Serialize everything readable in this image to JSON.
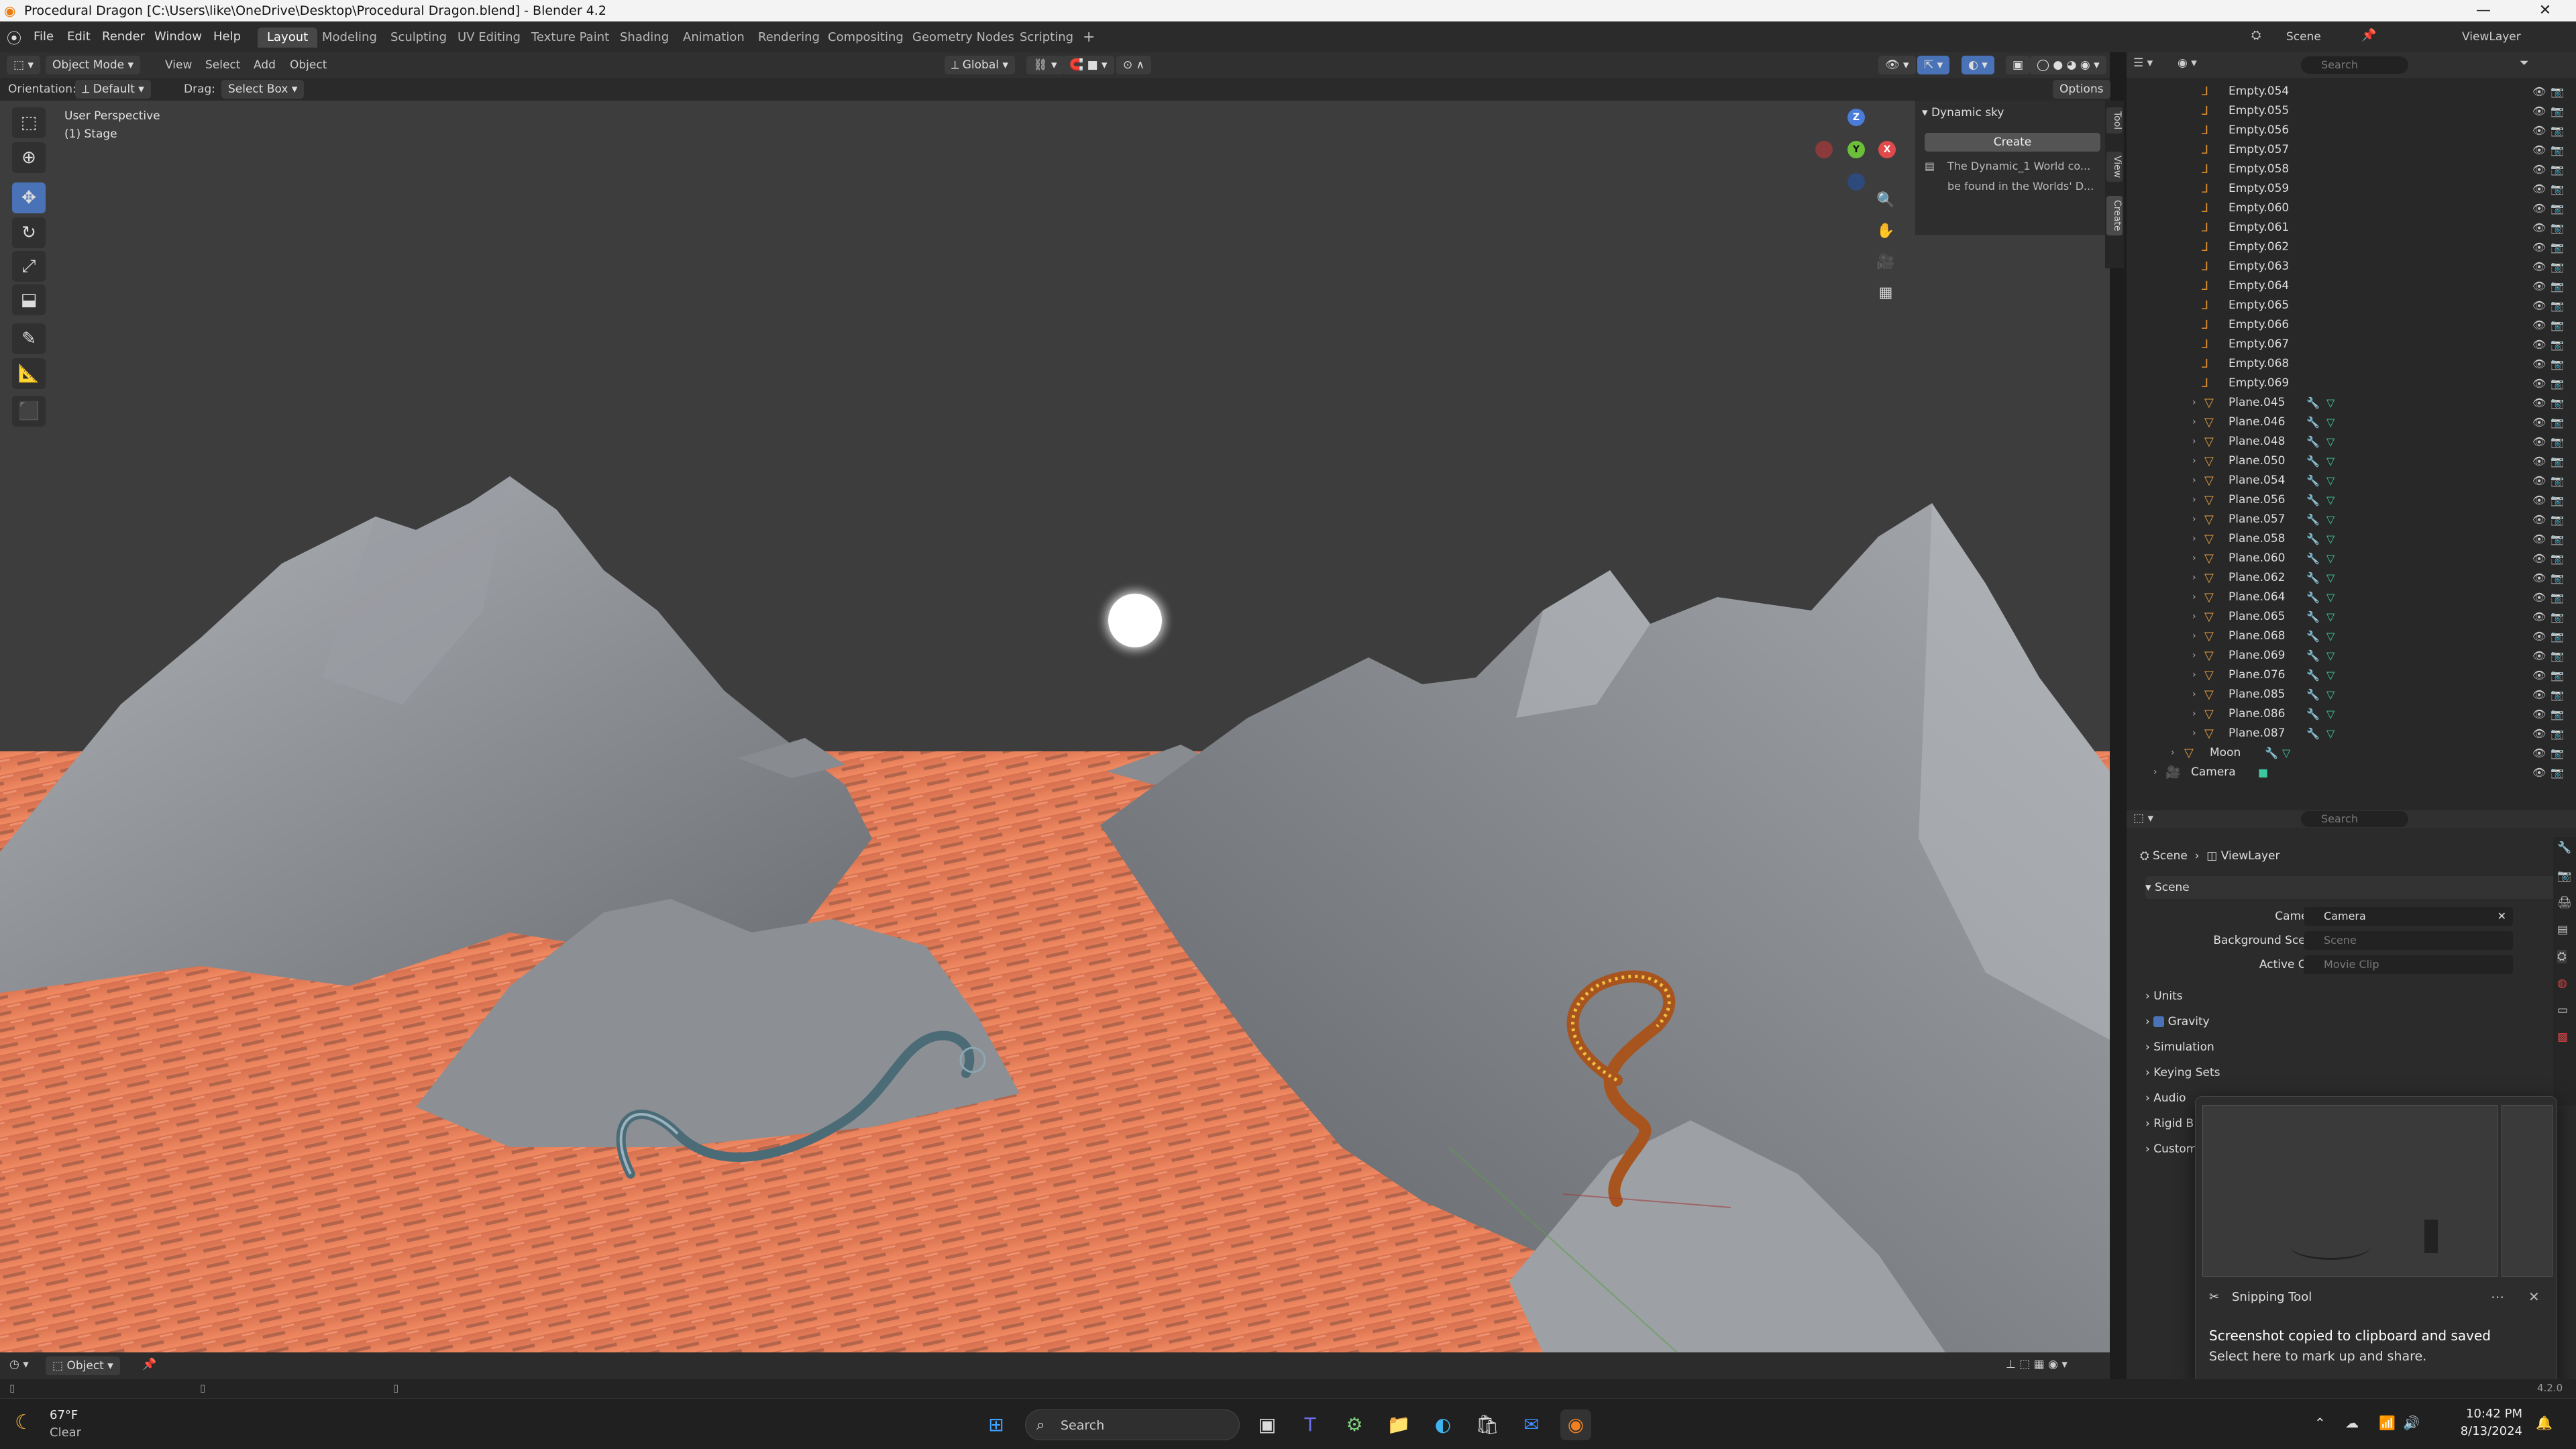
{
  "window": {
    "title": "Procedural Dragon [C:\\Users\\like\\OneDrive\\Desktop\\Procedural Dragon.blend] - Blender 4.2"
  },
  "menu": [
    "File",
    "Edit",
    "Render",
    "Window",
    "Help"
  ],
  "workspaces": [
    "Layout",
    "Modeling",
    "Sculpting",
    "UV Editing",
    "Texture Paint",
    "Shading",
    "Animation",
    "Rendering",
    "Compositing",
    "Geometry Nodes",
    "Scripting"
  ],
  "scene_selector": "Scene",
  "viewlayer_selector": "ViewLayer",
  "header": {
    "mode": "Object Mode",
    "menus": [
      "View",
      "Select",
      "Add",
      "Object"
    ],
    "transform_orientation": "Global",
    "orientation_label": "Orientation:",
    "orientation_value": "Default",
    "drag_label": "Drag:",
    "drag_value": "Select Box",
    "options": "Options",
    "search_placeholder": "Search"
  },
  "viewport": {
    "perspective": "User Perspective",
    "collection": "(1) Stage",
    "gizmo": {
      "z": "Z",
      "y": "Y",
      "x": "X"
    }
  },
  "npanel": {
    "title": "Dynamic sky",
    "create": "Create",
    "note1": "The Dynamic_1 World co...",
    "note2": "be found in the Worlds' D...",
    "tabs": [
      "Tool",
      "View",
      "Create"
    ]
  },
  "outliner": {
    "search_placeholder": "Search",
    "empties": [
      "Empty.054",
      "Empty.055",
      "Empty.056",
      "Empty.057",
      "Empty.058",
      "Empty.059",
      "Empty.060",
      "Empty.061",
      "Empty.062",
      "Empty.063",
      "Empty.064",
      "Empty.065",
      "Empty.066",
      "Empty.067",
      "Empty.068",
      "Empty.069"
    ],
    "planes": [
      "Plane.045",
      "Plane.046",
      "Plane.048",
      "Plane.050",
      "Plane.054",
      "Plane.056",
      "Plane.057",
      "Plane.058",
      "Plane.060",
      "Plane.062",
      "Plane.064",
      "Plane.065",
      "Plane.068",
      "Plane.069",
      "Plane.076",
      "Plane.085",
      "Plane.086",
      "Plane.087"
    ],
    "moon": "Moon",
    "camera": "Camera"
  },
  "properties": {
    "search_placeholder": "Search",
    "breadcrumb": [
      "Scene",
      "ViewLayer"
    ],
    "section": "Scene",
    "camera_label": "Camera",
    "camera_value": "Camera",
    "bg_label": "Background Scene",
    "bg_placeholder": "Scene",
    "clip_label": "Active Clip",
    "clip_placeholder": "Movie Clip",
    "subsections": [
      "Units",
      "Gravity",
      "Simulation",
      "Keying Sets",
      "Audio",
      "Rigid B",
      "Custom"
    ]
  },
  "footer": {
    "mode": "Object"
  },
  "version": "4.2.0",
  "toast": {
    "app": "Snipping Tool",
    "title": "Screenshot copied to clipboard and saved",
    "body": "Select here to mark up and share."
  },
  "taskbar": {
    "weather_temp": "67°F",
    "weather_desc": "Clear",
    "search": "Search",
    "time": "10:42 PM",
    "date": "8/13/2024"
  },
  "colors": {
    "accent": "#4a72b7",
    "lava": "#e87a55",
    "rock": "#8a8d92"
  }
}
